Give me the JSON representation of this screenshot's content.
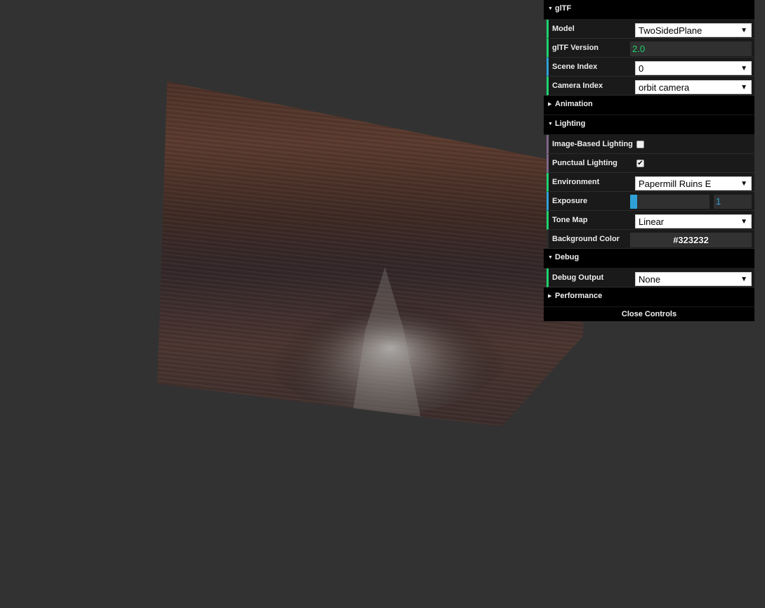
{
  "scene": {
    "background_color": "#323232"
  },
  "gui": {
    "gltf_folder": {
      "title": "glTF",
      "model": {
        "label": "Model",
        "value": "TwoSidedPlane"
      },
      "version": {
        "label": "glTF Version",
        "value": "2.0"
      },
      "scene_index": {
        "label": "Scene Index",
        "value": "0"
      },
      "camera_index": {
        "label": "Camera Index",
        "value": "orbit camera"
      }
    },
    "animation_folder": {
      "title": "Animation"
    },
    "lighting_folder": {
      "title": "Lighting",
      "ibl": {
        "label": "Image-Based Lighting",
        "checked": false
      },
      "punctual": {
        "label": "Punctual Lighting",
        "checked": true
      },
      "environment": {
        "label": "Environment",
        "value": "Papermill Ruins E"
      },
      "exposure": {
        "label": "Exposure",
        "value": "1",
        "fraction": 0.09
      },
      "tone_map": {
        "label": "Tone Map",
        "value": "Linear"
      },
      "background_color": {
        "label": "Background Color",
        "value": "#323232"
      }
    },
    "debug_folder": {
      "title": "Debug",
      "debug_output": {
        "label": "Debug Output",
        "value": "None"
      }
    },
    "performance_folder": {
      "title": "Performance"
    },
    "close_label": "Close Controls"
  }
}
